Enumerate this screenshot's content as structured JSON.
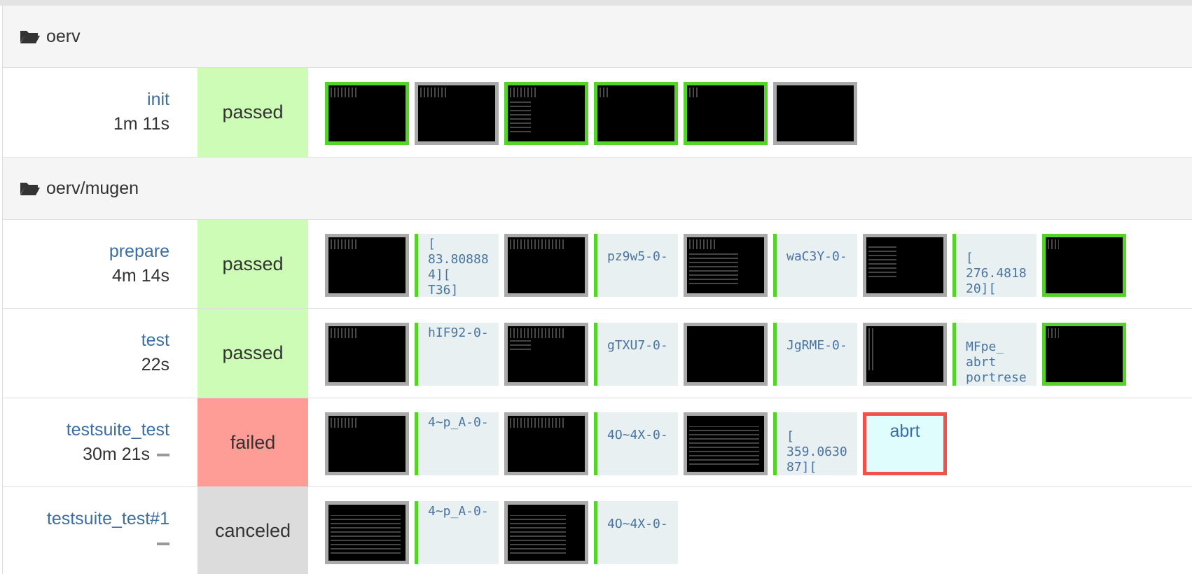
{
  "groups": [
    {
      "label": "oerv",
      "icon": "folder-open-icon"
    },
    {
      "label": "oerv/mugen",
      "icon": "folder-open-icon"
    }
  ],
  "modules": [
    {
      "name": "init",
      "duration": "1m 11s",
      "result": "passed"
    },
    {
      "name": "prepare",
      "duration": "4m 14s",
      "result": "passed",
      "texts": [
        "[\n83.80888\n4][\nT36]",
        "pz9w5-0-",
        "waC3Y-0-",
        "[\n276.4818\n20]["
      ]
    },
    {
      "name": "test",
      "duration": "22s",
      "result": "passed",
      "texts": [
        "hIF92-0-",
        "gTXU7-0-",
        "JgRME-0-",
        "MFpe_\nabrt\nportrese"
      ]
    },
    {
      "name": "testsuite_test",
      "duration": "30m 21s",
      "result": "failed",
      "texts": [
        "4~p_A-0-",
        "4O~4X-0-",
        "[\n359.0630\n87]["
      ],
      "fail_label": "abrt"
    },
    {
      "name": "testsuite_test#1",
      "duration": "",
      "result": "canceled",
      "texts": [
        "4~p_A-0-",
        "4O~4X-0-"
      ]
    }
  ],
  "colors": {
    "passed": "#ccfcb5",
    "failed": "#fe9d96",
    "canceled": "#dcdcdc",
    "ok_border": "#55d32b",
    "neutral_border": "#aaaaaa",
    "fail_border": "#f0524a"
  }
}
